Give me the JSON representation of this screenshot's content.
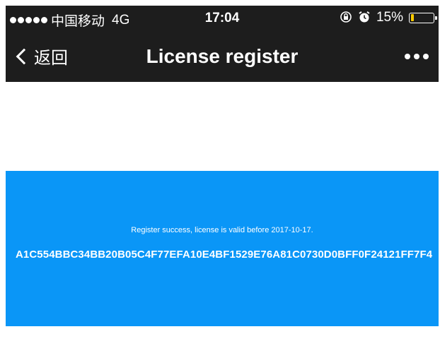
{
  "status_bar": {
    "carrier": "中国移动",
    "network": "4G",
    "time": "17:04",
    "battery_percent": "15%",
    "battery_level": 0.15,
    "battery_color": "#ffcc00",
    "icons": [
      "signal-dots-icon",
      "orientation-lock-icon",
      "alarm-icon",
      "battery-icon"
    ]
  },
  "nav": {
    "back_label": "返回",
    "title": "License register",
    "more_icon": "more-dots-icon"
  },
  "result": {
    "message": "Register success, license is valid before 2017-10-17.",
    "license_key": "A1C554BBC34BB20B05C4F77EFA10E4BF1529E76A81C0730D0BFF0F24121FF7F4",
    "background_color": "#0a96f7"
  }
}
